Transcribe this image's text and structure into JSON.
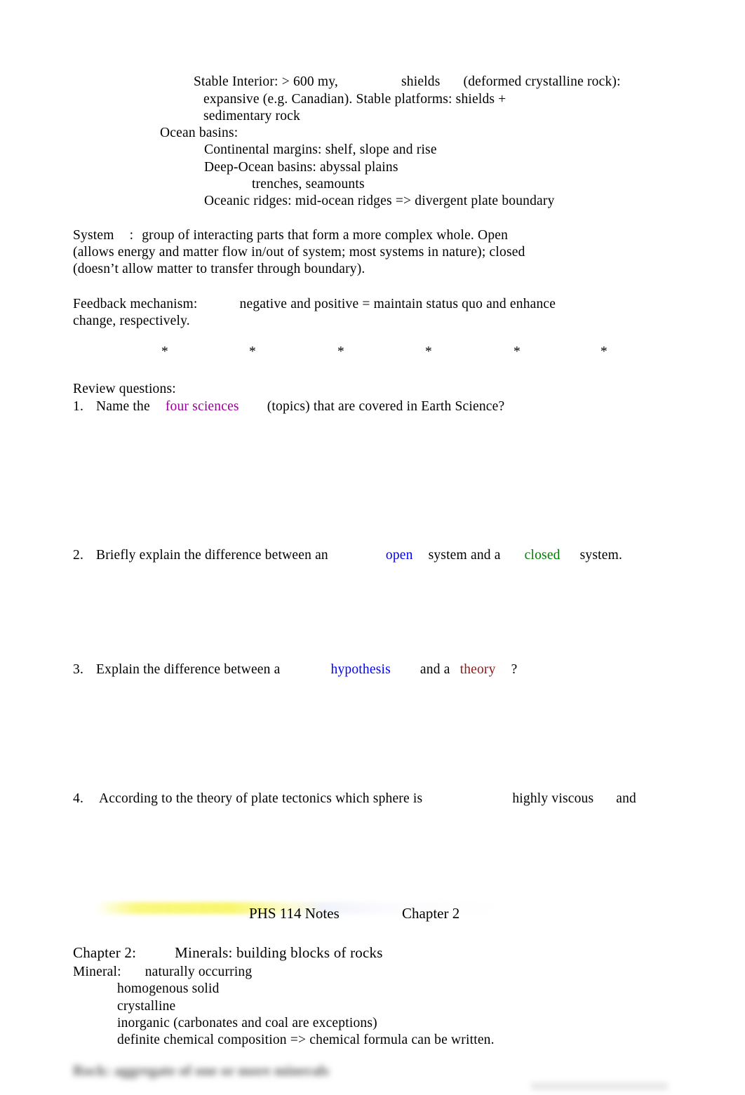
{
  "document": {
    "outline": {
      "stable_interior": {
        "line1_a": "Stable Interior: > 600 my,",
        "line1_b": "shields",
        "line1_c": "(deformed crystalline rock):",
        "line2": "expansive (e.g. Canadian). Stable platforms: shields +",
        "line3": "sedimentary rock"
      },
      "ocean_basins": {
        "heading": "Ocean basins:",
        "items": [
          "Continental margins: shelf, slope and rise",
          "Deep-Ocean basins: abyssal plains",
          "trenches, seamounts",
          "Oceanic ridges: mid-ocean ridges => divergent plate boundary"
        ]
      }
    },
    "system_paragraph": {
      "term": "System",
      "colon": ":",
      "line1": "group of interacting parts that form a more complex whole. Open",
      "line2": "(allows energy and matter flow in/out of system; most systems in nature); closed",
      "line3": "(doesn’t allow matter to transfer through boundary)."
    },
    "feedback_paragraph": {
      "term": "Feedback mechanism:",
      "line1": "negative and positive = maintain status quo and enhance",
      "line2": "change, respectively."
    },
    "separator": {
      "glyph": "*",
      "count": 6
    },
    "review": {
      "heading": "Review questions:",
      "questions": [
        {
          "number": "1.",
          "pre": "Name the",
          "keyword": "four sciences",
          "keyword_color": "#990099",
          "post": "(topics) that are covered in Earth Science?"
        },
        {
          "number": "2.",
          "pre": "Briefly explain the difference between an",
          "keyword": "open",
          "keyword_color": "#0000ff",
          "mid": "system and a",
          "keyword2": "closed",
          "keyword2_color": "#008000",
          "post": "system."
        },
        {
          "number": "3.",
          "pre": "Explain the difference between a",
          "keyword": "hypothesis",
          "keyword_color": "#0000ff",
          "mid": "and a",
          "keyword2": "theory",
          "keyword2_color": "#8b1a1a",
          "post": "?"
        },
        {
          "number": "4.",
          "pre": "According to the theory of plate tectonics which sphere is",
          "keyword": "highly viscous",
          "keyword_color": "#000000",
          "post": "and"
        }
      ]
    },
    "page_header": {
      "course": "PHS 114 Notes",
      "chapter": "Chapter 2"
    },
    "chapter2": {
      "label": "Chapter 2:",
      "title": "Minerals: building blocks of rocks",
      "mineral_label": "Mineral:",
      "mineral_first": "naturally occurring",
      "properties": [
        "homogenous solid",
        "crystalline",
        "inorganic (carbonates and coal are exceptions)",
        "definite chemical composition => chemical formula can be written."
      ],
      "rock_line_blurred": "Rock: aggregate of one or more minerals"
    }
  }
}
